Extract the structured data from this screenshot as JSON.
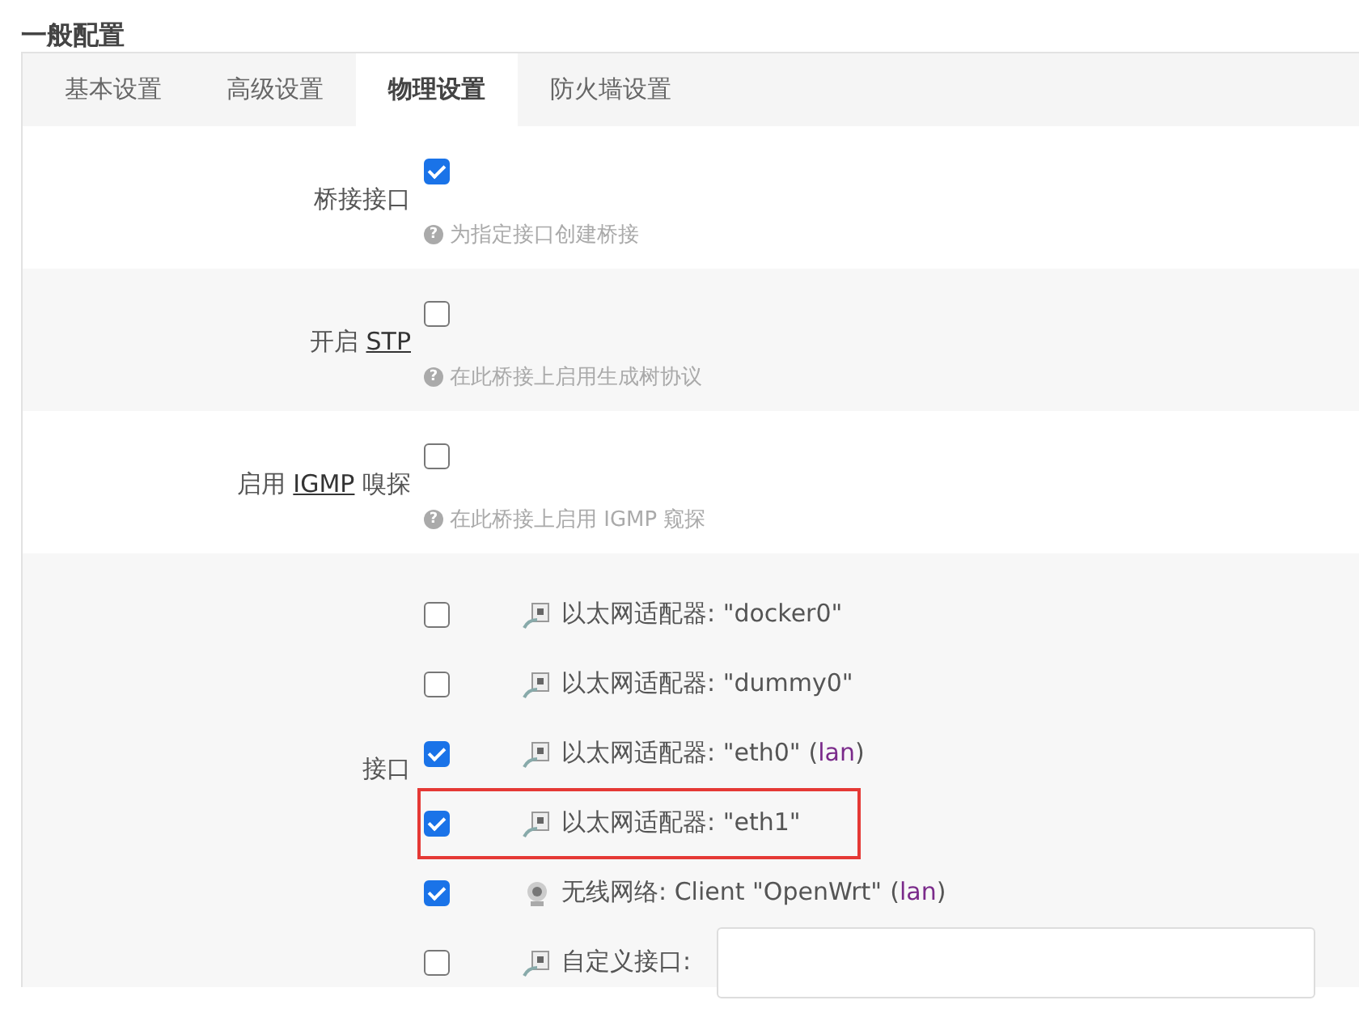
{
  "section_title": "一般配置",
  "tabs": [
    {
      "label": "基本设置",
      "selected": false
    },
    {
      "label": "高级设置",
      "selected": false
    },
    {
      "label": "物理设置",
      "selected": true
    },
    {
      "label": "防火墙设置",
      "selected": false
    }
  ],
  "options": [
    {
      "label_before": "桥接接口",
      "checked": true,
      "help_icon": "?",
      "help": "为指定接口创建桥接"
    },
    {
      "label_before": "开启 ",
      "abbr": "STP",
      "checked": false,
      "help_icon": "?",
      "help": "在此桥接上启用生成树协议"
    },
    {
      "label_before": "启用 ",
      "abbr": "IGMP",
      "label_after": " 嗅探",
      "checked": false,
      "help_icon": "?",
      "help": "在此桥接上启用 IGMP 窥探"
    }
  ],
  "interfaces": {
    "label": "接口",
    "items": [
      {
        "kind": "ethernet",
        "checked": false,
        "highlighted": false,
        "name": "以太网适配器: \"docker0\""
      },
      {
        "kind": "ethernet",
        "checked": false,
        "highlighted": false,
        "name": "以太网适配器: \"dummy0\""
      },
      {
        "kind": "ethernet",
        "checked": true,
        "highlighted": false,
        "name": "以太网适配器: \"eth0\"",
        "network": {
          "open": "(",
          "name": "lan",
          "close": ")"
        }
      },
      {
        "kind": "ethernet",
        "checked": true,
        "highlighted": true,
        "name": "以太网适配器: \"eth1\""
      },
      {
        "kind": "wireless",
        "checked": true,
        "highlighted": false,
        "name": "无线网络: Client \"OpenWrt\"",
        "network": {
          "open": "(",
          "name": "lan",
          "close": ")"
        }
      },
      {
        "kind": "custom",
        "checked": false,
        "highlighted": false,
        "name": "自定义接口:"
      }
    ]
  }
}
